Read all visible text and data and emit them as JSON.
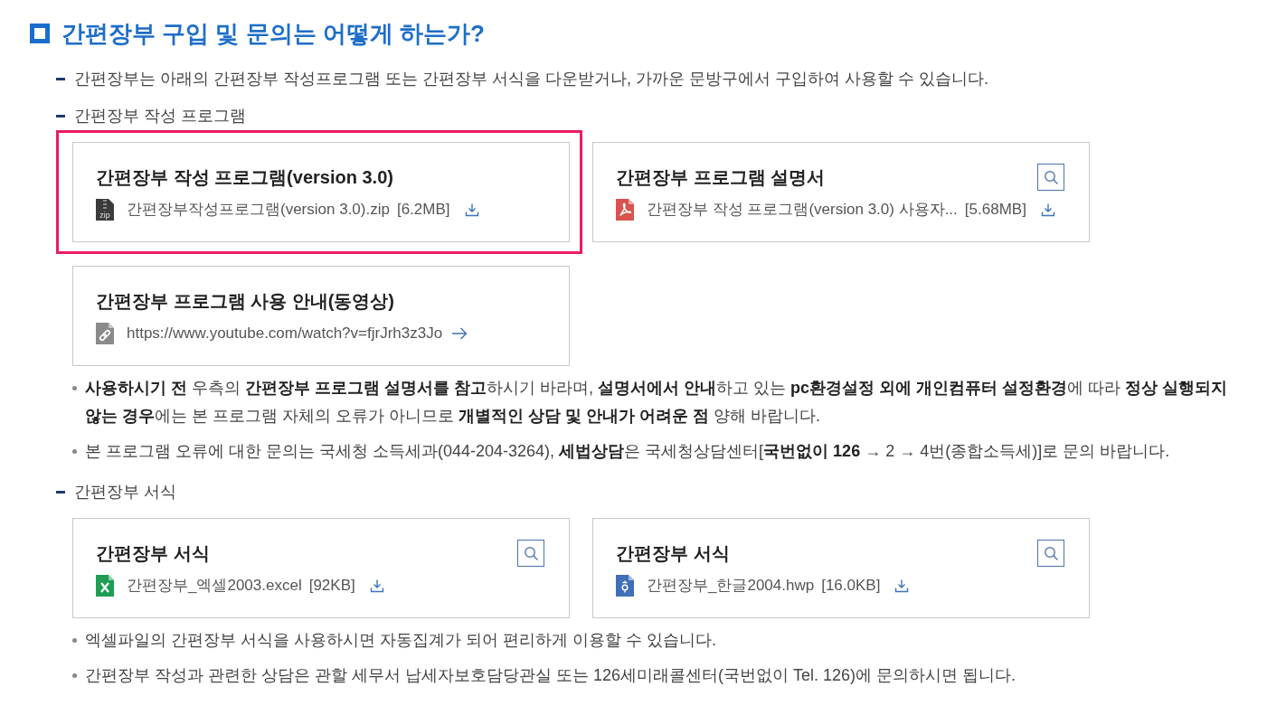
{
  "heading": {
    "title": "간편장부 구입 및 문의는 어떻게 하는가?"
  },
  "items": [
    {
      "text": "간편장부는 아래의 간편장부 작성프로그램 또는 간편장부 서식을 다운받거나, 가까운 문방구에서 구입하여 사용할 수 있습니다."
    },
    {
      "text": "간편장부 작성 프로그램",
      "cards": [
        {
          "title": "간편장부 작성 프로그램(version 3.0)",
          "highlighted": true,
          "preview": false,
          "file": {
            "kind": "zip",
            "badge": "zip",
            "name": "간편장부작성프로그램(version 3.0).zip",
            "size": "[6.2MB]",
            "action": {
              "kind": "download"
            }
          }
        },
        {
          "title": "간편장부 프로그램 설명서",
          "highlighted": false,
          "preview": true,
          "file": {
            "kind": "pdf",
            "name": "간편장부 작성 프로그램(version 3.0) 사용자...",
            "size": "[5.68MB]",
            "action": {
              "kind": "download"
            }
          }
        },
        {
          "title": "간편장부 프로그램 사용 안내(동영상)",
          "highlighted": false,
          "preview": false,
          "file": {
            "kind": "link",
            "name": "https://www.youtube.com/watch?v=fjrJrh3z3Jo",
            "action": {
              "kind": "open"
            }
          }
        }
      ],
      "notes": [
        "**사용하시기 전** 우측의 **간편장부 프로그램 설명서를 참고**하시기 바라며, **설명서에서 안내**하고 있는 **pc환경설정 외에 개인컴퓨터 설정환경**에 따라 **정상 실행되지 않는 경우**에는 본 프로그램 자체의 오류가 아니므로 **개별적인 상담 및 안내가 어려운 점** 양해 바랍니다.",
        "본 프로그램 오류에 대한 문의는 국세청 소득세과(044-204-3264), **세법상담**은 국세청상담센터[**국번없이 126** → 2 → 4번(종합소득세)]로 문의 바랍니다."
      ]
    },
    {
      "text": "간편장부 서식",
      "cards": [
        {
          "title": "간편장부 서식",
          "highlighted": false,
          "preview": true,
          "file": {
            "kind": "excel",
            "name": "간편장부_엑셀2003.excel",
            "size": "[92KB]",
            "action": {
              "kind": "download"
            }
          }
        },
        {
          "title": "간편장부 서식",
          "highlighted": false,
          "preview": true,
          "file": {
            "kind": "hwp",
            "name": "간편장부_한글2004.hwp",
            "size": "[16.0KB]",
            "action": {
              "kind": "download"
            }
          }
        }
      ],
      "notes": [
        "엑셀파일의 간편장부 서식을 사용하시면 자동집계가 되어 편리하게 이용할 수 있습니다.",
        "간편장부 작성과 관련한 상담은 관할 세무서 납세자보호담당관실 또는 126세미래콜센터(국번없이 Tel. 126)에 문의하시면 됩니다."
      ]
    }
  ]
}
